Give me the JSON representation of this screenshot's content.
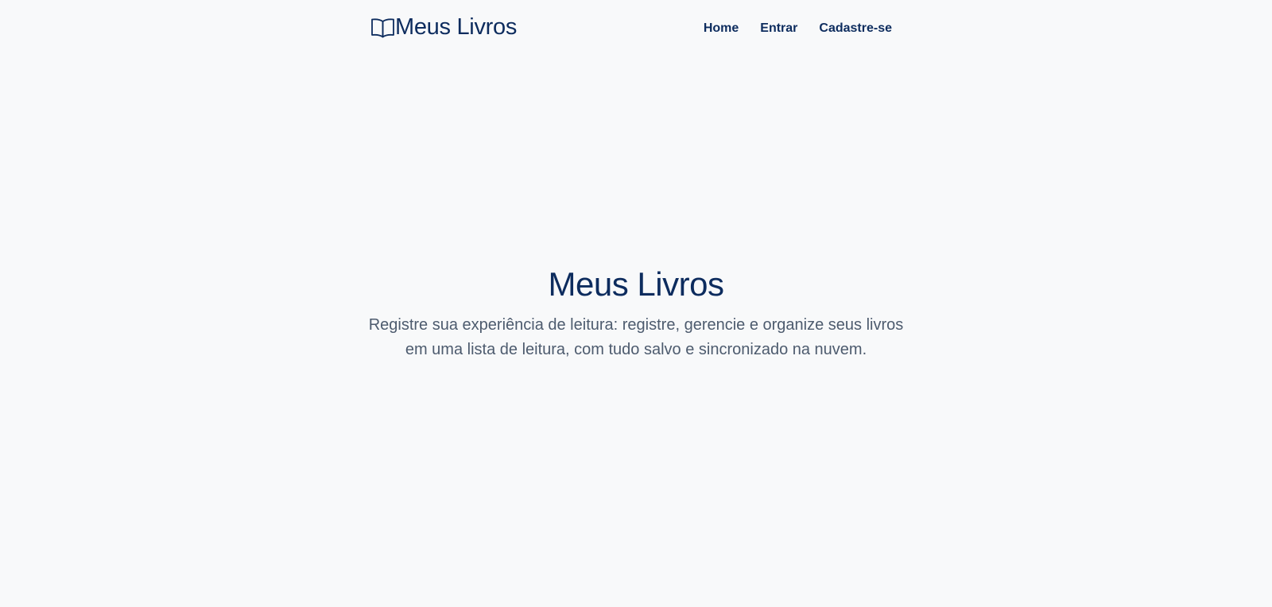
{
  "navbar": {
    "brand": {
      "icon": "open-book-icon",
      "text": "Meus Livros"
    },
    "links": [
      {
        "label": "Home"
      },
      {
        "label": "Entrar"
      },
      {
        "label": "Cadastre-se"
      }
    ]
  },
  "hero": {
    "title": "Meus Livros",
    "description": "Registre sua experiência de leitura: registre, gerencie e organize seus livros em uma lista de leitura, com tudo salvo e sincronizado na nuvem."
  },
  "colors": {
    "background": "#f8f9fa",
    "primary": "#0d2c5e",
    "muted_text": "#4d5b6e"
  }
}
